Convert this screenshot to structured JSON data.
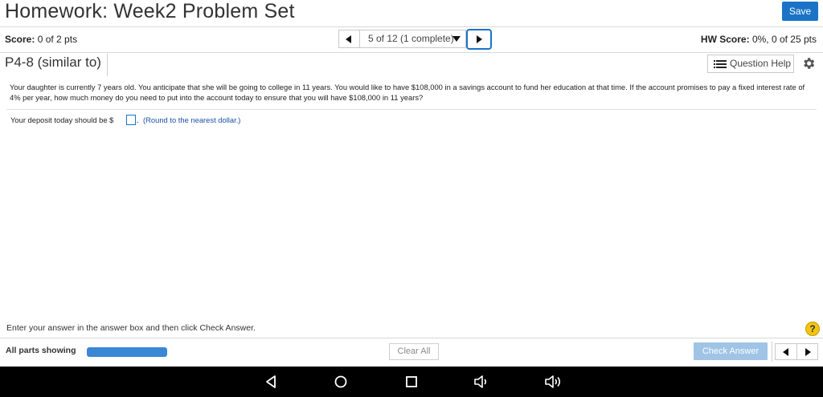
{
  "header": {
    "title": "Homework: Week2 Problem Set",
    "save_label": "Save"
  },
  "scorebar": {
    "score_label": "Score:",
    "score_value": "0 of 2 pts",
    "nav_label": "5 of 12 (1 complete)",
    "hw_score_label": "HW Score:",
    "hw_score_value": "0%, 0 of 25 pts"
  },
  "problem": {
    "id": "P4-8 (similar to)",
    "question_help_label": "Question Help",
    "question_text": "Your daughter is currently 7 years old.  You anticipate that she will be going to college in 11 years. You would like to have $108,000 in a savings account to fund her education at that time.  If the account promises to pay a fixed interest rate of 4% per year, how much money do you need to put into the account today to ensure that you will have $108,000 in 11 years?",
    "deposit_prefix": "Your deposit today should be $",
    "deposit_suffix": ".",
    "round_note": "(Round to the nearest dollar.)",
    "answer_value": ""
  },
  "footer": {
    "instruction": "Enter your answer in the answer box and then click Check Answer.",
    "help_symbol": "?",
    "parts_label": "All parts showing",
    "progress_fraction": 1.0,
    "clear_label": "Clear All",
    "check_label": "Check Answer"
  },
  "colors": {
    "accent": "#1a73c7",
    "progress": "#3a87d6",
    "check_disabled": "#9fc4e6",
    "help": "#f2c514"
  },
  "android_nav": {
    "icons": [
      "back-icon",
      "home-icon",
      "recents-icon",
      "volume-down-icon",
      "volume-up-icon"
    ]
  }
}
